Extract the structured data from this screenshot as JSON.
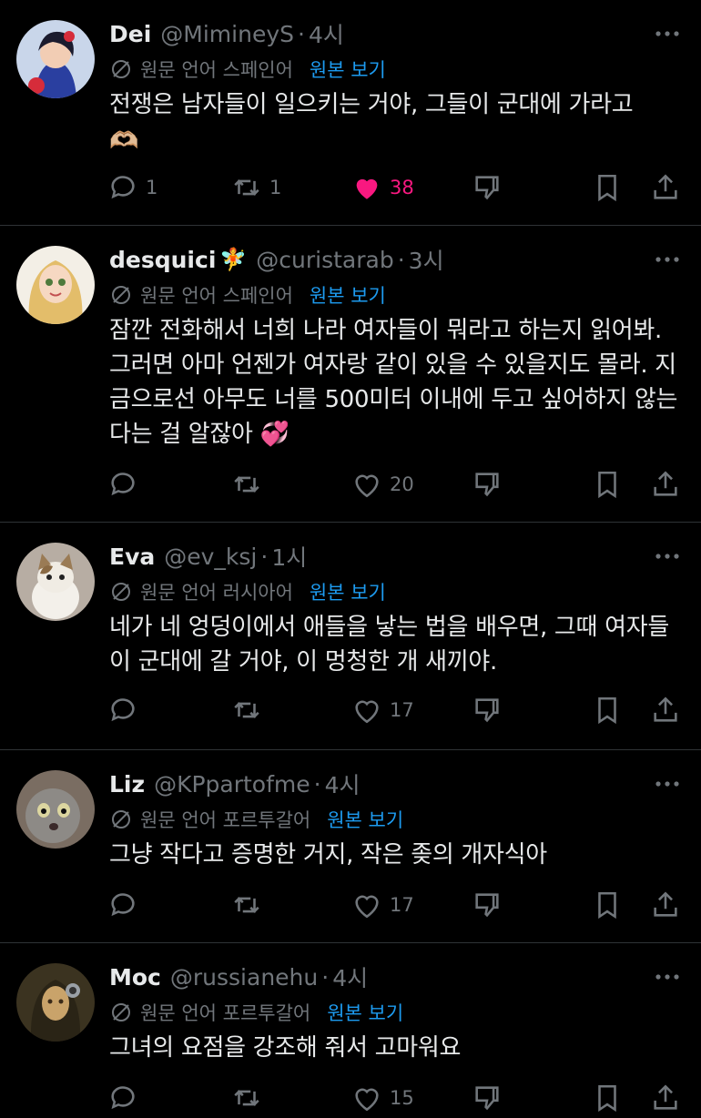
{
  "colors": {
    "background": "#000000",
    "text": "#e7e9ea",
    "muted": "#71767b",
    "link": "#1d9bf0",
    "like_active": "#f91880",
    "divider": "#2f3336"
  },
  "tweets": [
    {
      "name": "Dei",
      "name_emoji": "",
      "handle": "@MimineyS",
      "time": "4시",
      "lang": "원문 언어 스페인어",
      "show": "원본 보기",
      "text": "전쟁은 남자들이 일으키는 거야, 그들이 군대에 가라고",
      "text2": "🫶🏼",
      "replies": "1",
      "retweets": "1",
      "likes": "38",
      "liked": true
    },
    {
      "name": "desquici",
      "name_emoji": "🧚",
      "handle": "@curistarab",
      "time": "3시",
      "lang": "원문 언어 스페인어",
      "show": "원본 보기",
      "text": "잠깐 전화해서 너희 나라 여자들이 뭐라고 하는지 읽어봐. 그러면 아마 언젠가 여자랑 같이 있을 수 있을지도 몰라. 지금으로선 아무도 너를 500미터 이내에 두고 싶어하지 않는다는 걸 알잖아",
      "text2": "💞",
      "replies": "",
      "retweets": "",
      "likes": "20",
      "liked": false
    },
    {
      "name": "Eva",
      "name_emoji": "",
      "handle": "@ev_ksj",
      "time": "1시",
      "lang": "원문 언어 러시아어",
      "show": "원본 보기",
      "text": "네가 네 엉덩이에서 애들을 낳는 법을 배우면, 그때 여자들이 군대에 갈 거야, 이 멍청한 개 새끼야.",
      "text2": "",
      "replies": "",
      "retweets": "",
      "likes": "17",
      "liked": false
    },
    {
      "name": "Liz",
      "name_emoji": "",
      "handle": "@KPpartofme",
      "time": "4시",
      "lang": "원문 언어 포르투갈어",
      "show": "원본 보기",
      "text": "그냥 작다고 증명한 거지, 작은 좆의 개자식아",
      "text2": "",
      "replies": "",
      "retweets": "",
      "likes": "17",
      "liked": false
    },
    {
      "name": "Moc",
      "name_emoji": "",
      "handle": "@russianehu",
      "time": "4시",
      "lang": "원문 언어 포르투갈어",
      "show": "원본 보기",
      "text": "그녀의 요점을 강조해 줘서 고마워요",
      "text2": "",
      "replies": "",
      "retweets": "",
      "likes": "15",
      "liked": false
    }
  ]
}
